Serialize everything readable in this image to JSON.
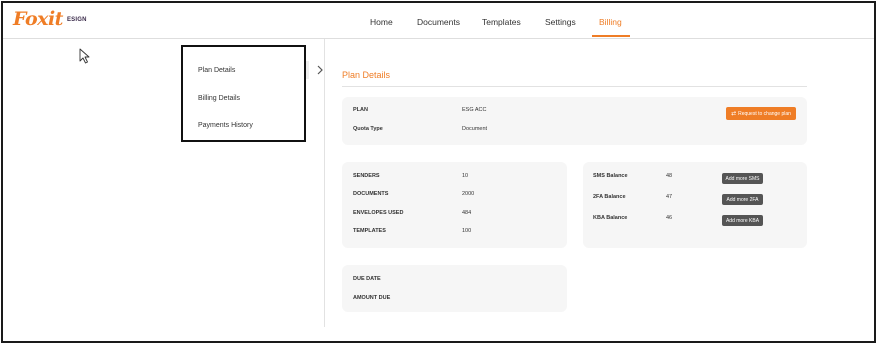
{
  "logo": {
    "word": "Foxit",
    "sub": "ESIGN"
  },
  "nav": [
    {
      "label": "Home"
    },
    {
      "label": "Documents"
    },
    {
      "label": "Templates"
    },
    {
      "label": "Settings"
    },
    {
      "label": "Billing",
      "active": true
    }
  ],
  "sidebar": {
    "items": [
      {
        "label": "Plan Details",
        "active": true
      },
      {
        "label": "Billing Details"
      },
      {
        "label": "Payments History"
      }
    ]
  },
  "main": {
    "title": "Plan Details",
    "plan_card": {
      "plan_label": "PLAN",
      "plan_value": "ESG ACC",
      "quota_label": "Quota Type",
      "quota_value": "Document",
      "change_button": "Request to change plan"
    },
    "usage_card": {
      "rows": [
        {
          "label": "SENDERS",
          "value": "10"
        },
        {
          "label": "DOCUMENTS",
          "value": "2000"
        },
        {
          "label": "ENVELOPES USED",
          "value": "484"
        },
        {
          "label": "TEMPLATES",
          "value": "100"
        }
      ]
    },
    "balance_card": {
      "rows": [
        {
          "label": "SMS Balance",
          "value": "48",
          "button": "Add more SMS"
        },
        {
          "label": "2FA Balance",
          "value": "47",
          "button": "Add more 2FA"
        },
        {
          "label": "KBA Balance",
          "value": "46",
          "button": "Add more KBA"
        }
      ]
    },
    "due_card": {
      "due_date_label": "DUE DATE",
      "amount_due_label": "AMOUNT DUE"
    }
  },
  "colors": {
    "accent": "#ef7d26",
    "card_bg": "#f6f6f6",
    "dark_button": "#555555"
  }
}
